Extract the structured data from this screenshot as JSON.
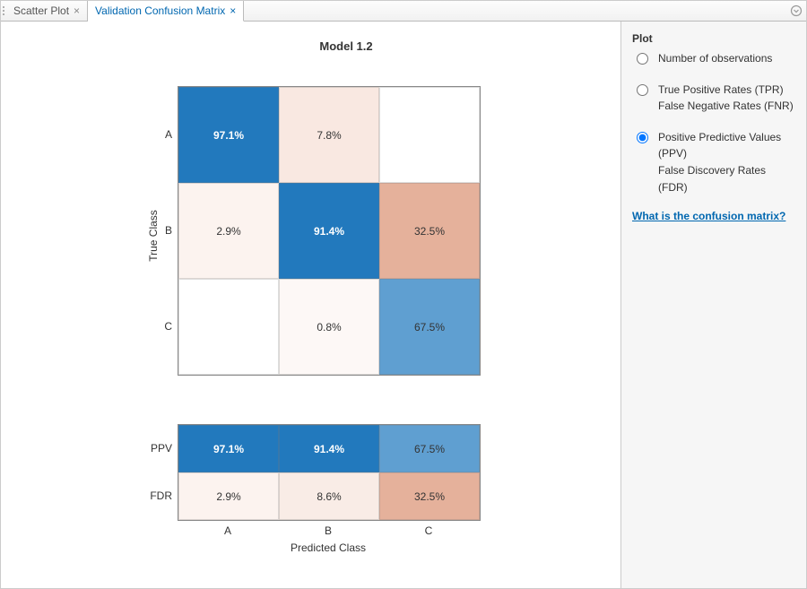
{
  "tabs": {
    "scatter": {
      "label": "Scatter Plot"
    },
    "confusion": {
      "label": "Validation Confusion Matrix"
    }
  },
  "plot": {
    "title": "Model 1.2",
    "ylabel": "True Class",
    "xlabel": "Predicted Class",
    "row_labels": [
      "A",
      "B",
      "C"
    ],
    "col_labels": [
      "A",
      "B",
      "C"
    ],
    "summary_row_labels": [
      "PPV",
      "FDR"
    ]
  },
  "chart_data": {
    "type": "heatmap",
    "matrix": [
      [
        "97.1%",
        "7.8%",
        ""
      ],
      [
        "2.9%",
        "91.4%",
        "32.5%"
      ],
      [
        "",
        "0.8%",
        "67.5%"
      ]
    ],
    "matrix_colors": [
      [
        "#2279bd",
        "#f9e8e1",
        "#ffffff"
      ],
      [
        "#fcf3ef",
        "#2279bd",
        "#e5b19b"
      ],
      [
        "#ffffff",
        "#fdf8f6",
        "#5f9fd1"
      ]
    ],
    "matrix_dark": [
      [
        true,
        false,
        false
      ],
      [
        false,
        true,
        false
      ],
      [
        false,
        false,
        false
      ]
    ],
    "summary": [
      [
        "97.1%",
        "91.4%",
        "67.5%"
      ],
      [
        "2.9%",
        "8.6%",
        "32.5%"
      ]
    ],
    "summary_colors": [
      [
        "#2279bd",
        "#2279bd",
        "#5f9fd1"
      ],
      [
        "#fcf3ef",
        "#f9ece6",
        "#e5b19b"
      ]
    ],
    "summary_dark": [
      [
        true,
        true,
        false
      ],
      [
        false,
        false,
        false
      ]
    ]
  },
  "sidepanel": {
    "title": "Plot",
    "opt1": "Number of observations",
    "opt2a": "True Positive Rates (TPR)",
    "opt2b": "False Negative Rates (FNR)",
    "opt3a": "Positive Predictive Values (PPV)",
    "opt3b": "False Discovery Rates (FDR)",
    "help": "What is the confusion matrix?"
  }
}
